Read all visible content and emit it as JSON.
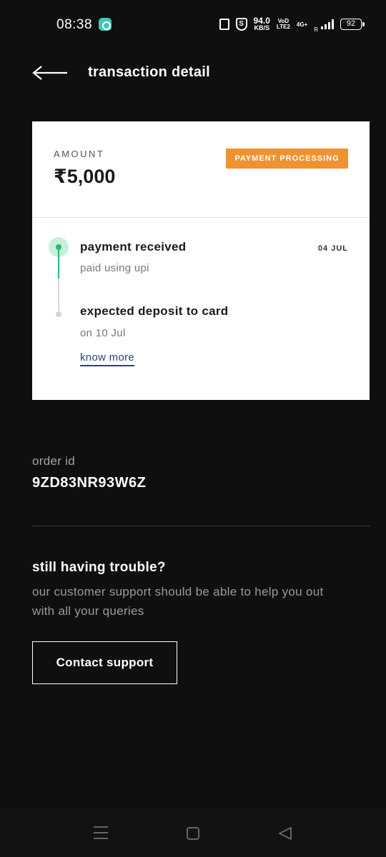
{
  "status_bar": {
    "time": "08:38",
    "speed_value": "94.0",
    "speed_unit": "KB/S",
    "volte_line1": "VoD",
    "volte_line2": "LTE2",
    "network": "4G+",
    "roaming": "R",
    "battery": "92",
    "icons": [
      "vibrate-icon",
      "shield-icon",
      "signal-icon",
      "battery-icon"
    ]
  },
  "header": {
    "title": "transaction detail",
    "back_icon": "back-arrow-icon"
  },
  "transaction": {
    "amount_label": "AMOUNT",
    "amount": "₹5,000",
    "status": "PAYMENT PROCESSING",
    "status_color": "#f0922f",
    "steps": [
      {
        "title": "payment received",
        "subtitle": "paid using upi",
        "date": "04 JUL",
        "state": "done"
      },
      {
        "title": "expected deposit to card",
        "subtitle": "on 10 Jul",
        "state": "pending"
      }
    ],
    "know_more": "know more",
    "accent_color": "#2bb673"
  },
  "order": {
    "label": "order id",
    "id": "9ZD83NR93W6Z"
  },
  "support": {
    "title": "still having trouble?",
    "description": "our customer support should be able to help you out with all your queries",
    "button_label": "Contact support"
  },
  "nav": {
    "icons": [
      "recents-icon",
      "home-icon",
      "back-icon"
    ]
  }
}
